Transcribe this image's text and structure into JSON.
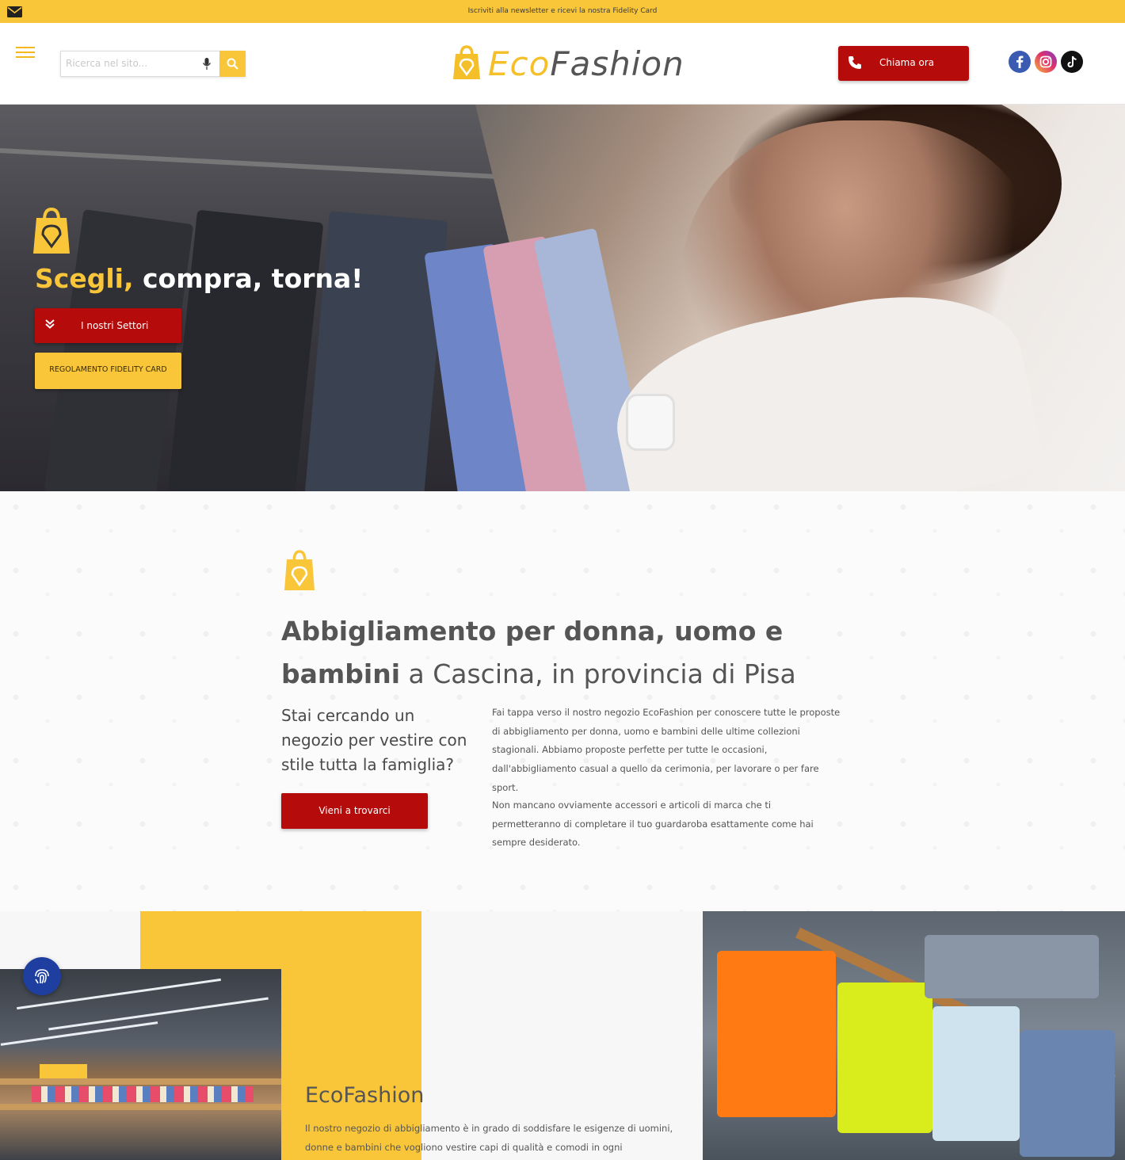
{
  "topbar": {
    "icon": "mail-icon",
    "message": "Iscriviti alla newsletter e ricevi la nostra Fidelity Card"
  },
  "header": {
    "search": {
      "placeholder": "Ricerca nel sito...",
      "value": ""
    },
    "logo": {
      "part1": "Eco",
      "part2": "Fashion"
    },
    "call_label": "Chiama ora",
    "social": [
      "facebook-icon",
      "instagram-icon",
      "tiktok-icon"
    ]
  },
  "hero": {
    "title_highlight": "Scegli,",
    "title_rest": "compra, torna!",
    "btn_primary": "I nostri Settori",
    "btn_secondary": "REGOLAMENTO FIDELITY CARD"
  },
  "intro": {
    "title_bold": "Abbigliamento per donna, uomo e bambini",
    "title_rest": "a Cascina, in provincia di Pisa",
    "question": "Stai cercando un negozio per vestire con stile tutta la famiglia?",
    "paragraph1": "Fai tappa verso il nostro negozio EcoFashion per conoscere tutte le proposte di abbigliamento per donna, uomo e bambini delle ultime collezioni stagionali. Abbiamo proposte perfette per tutte le occasioni, dall'abbigliamento casual a quello da cerimonia, per lavorare o per fare sport.",
    "paragraph2": "Non mancano ovviamente accessori e articoli di marca che ti permetteranno di completare il tuo guardaroba esattamente come hai sempre desiderato.",
    "button": "Vieni a trovarci"
  },
  "about": {
    "title": "EcoFashion",
    "text": "Il nostro negozio di abbigliamento è in grado di soddisfare le esigenze di uomini, donne e bambini che vogliono vestire capi di qualità e comodi in ogni"
  },
  "colors": {
    "accent": "#f9c63a",
    "primary_red": "#b50b0b",
    "fingerprint_blue": "#1f3fa0"
  }
}
